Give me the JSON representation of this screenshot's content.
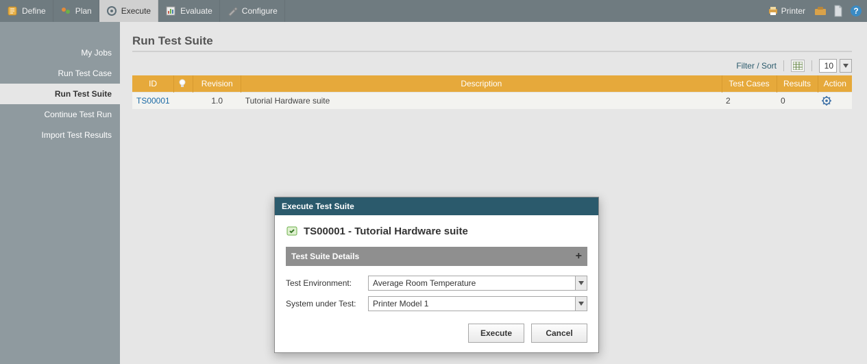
{
  "topnav": {
    "tabs": [
      {
        "label": "Define"
      },
      {
        "label": "Plan"
      },
      {
        "label": "Execute"
      },
      {
        "label": "Evaluate"
      },
      {
        "label": "Configure"
      }
    ],
    "printer_label": "Printer"
  },
  "sidebar": {
    "items": [
      {
        "label": "My Jobs"
      },
      {
        "label": "Run Test Case"
      },
      {
        "label": "Run Test Suite"
      },
      {
        "label": "Continue Test Run"
      },
      {
        "label": "Import Test Results"
      }
    ]
  },
  "page": {
    "title": "Run Test Suite",
    "filter_sort_label": "Filter / Sort",
    "page_size": "10"
  },
  "table": {
    "columns": {
      "id": "ID",
      "bulb": "",
      "revision": "Revision",
      "description": "Description",
      "test_cases": "Test Cases",
      "results": "Results",
      "action": "Action"
    },
    "rows": [
      {
        "id": "TS00001",
        "revision": "1.0",
        "description": "Tutorial Hardware suite",
        "test_cases": "2",
        "results": "0"
      }
    ]
  },
  "dialog": {
    "title": "Execute Test Suite",
    "suite_heading": "TS00001 - Tutorial Hardware suite",
    "section_label": "Test Suite Details",
    "env_label": "Test Environment:",
    "env_value": "Average Room Temperature",
    "sut_label": "System under Test:",
    "sut_value": "Printer Model 1",
    "execute_label": "Execute",
    "cancel_label": "Cancel"
  }
}
